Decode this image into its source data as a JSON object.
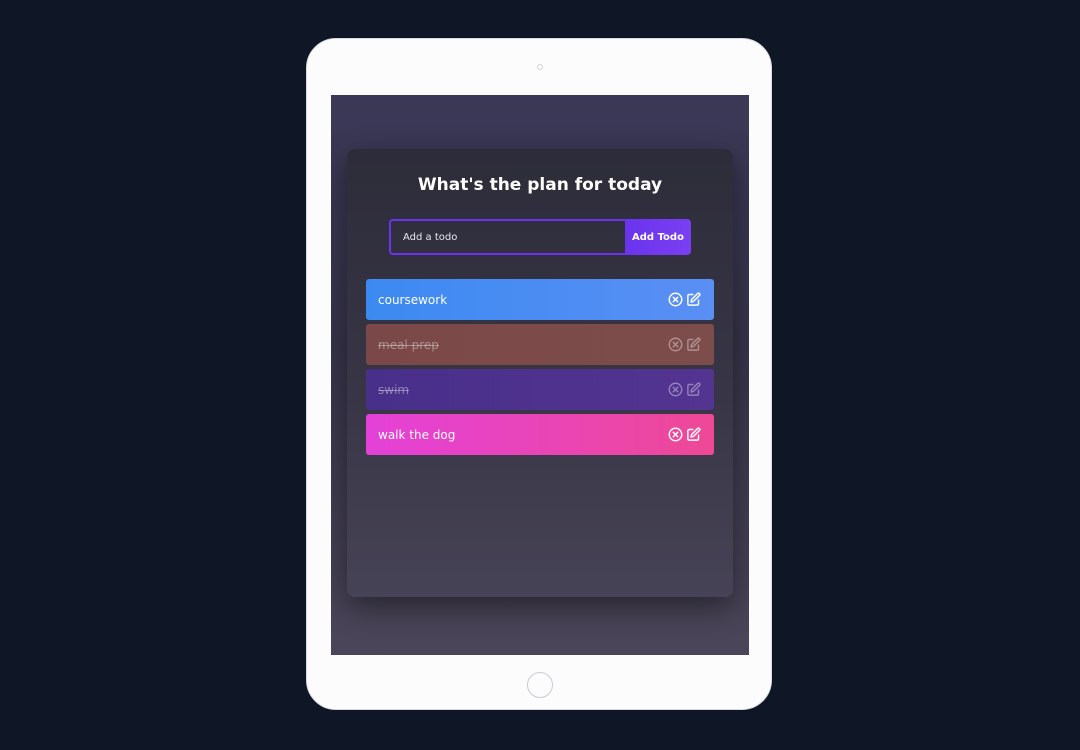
{
  "app": {
    "title": "What's the plan for today"
  },
  "form": {
    "placeholder": "Add a todo",
    "value": "",
    "add_label": "Add Todo"
  },
  "todos": [
    {
      "text": "coursework",
      "completed": false,
      "gradient": [
        "#3c8af1",
        "#5a8ff4"
      ]
    },
    {
      "text": "meal prep",
      "completed": true,
      "gradient": [
        "#7a4848",
        "#7c4d4a"
      ]
    },
    {
      "text": "swim",
      "completed": true,
      "gradient": [
        "#482f8a",
        "#533491"
      ]
    },
    {
      "text": "walk the dog",
      "completed": false,
      "gradient": [
        "#e441d8",
        "#ee4896"
      ]
    }
  ],
  "icons": {
    "delete": "close-circle-icon",
    "edit": "edit-icon"
  },
  "colors": {
    "accent": "#6a33ee",
    "background": "#0f1626"
  }
}
